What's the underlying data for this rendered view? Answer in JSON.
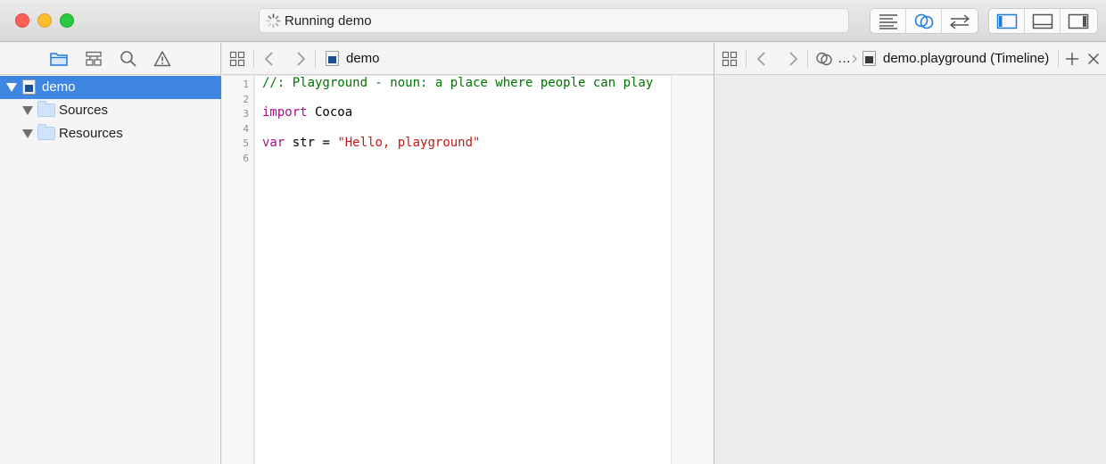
{
  "toolbar": {
    "activity_text": "Running demo"
  },
  "navigator": {
    "tabs": [
      {
        "icon": "folder-icon"
      },
      {
        "icon": "symbol-hierarchy-icon"
      },
      {
        "icon": "search-icon"
      },
      {
        "icon": "warning-icon"
      }
    ],
    "tree": [
      {
        "label": "demo",
        "selected": true
      },
      {
        "label": "Sources"
      },
      {
        "label": "Resources"
      }
    ]
  },
  "editor": {
    "breadcrumb_file": "demo",
    "line_numbers": [
      "1",
      "2",
      "3",
      "4",
      "5",
      "6"
    ],
    "code": {
      "line1_comment": "//: Playground - noun: a place where people can play",
      "line3_kw": "import",
      "line3_rest": " Cocoa",
      "line5_kw": "var",
      "line5_mid": " str = ",
      "line5_str": "\"Hello, playground\""
    }
  },
  "assistant": {
    "ellipsis": "…",
    "breadcrumb_file": "demo.playground (Timeline)"
  },
  "colors": {
    "selection": "#3e86e2",
    "comment": "#007400",
    "keyword": "#aa0d91",
    "string": "#c41a16",
    "toolbar_accent": "#1f7ae0"
  }
}
